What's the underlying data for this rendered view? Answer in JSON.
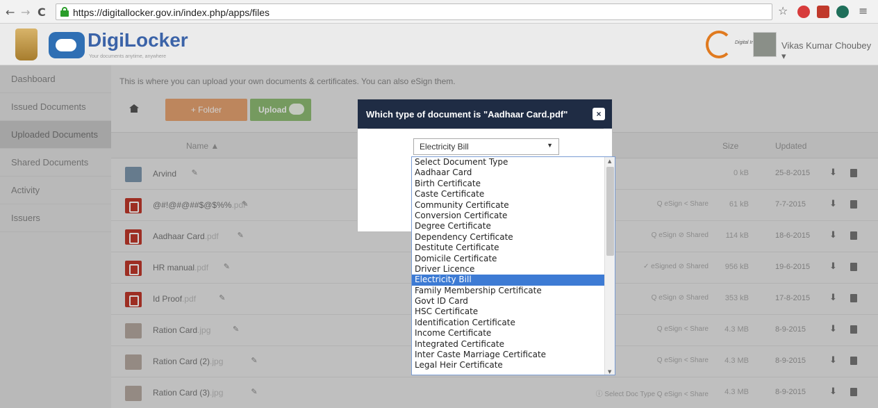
{
  "browser": {
    "url": "https://digitallocker.gov.in/index.php/apps/files",
    "back": "←",
    "forward": "→",
    "reload": "C",
    "menu": "≡",
    "star": "☆"
  },
  "header": {
    "brand": "DigiLocker",
    "tagline": "Your documents anytime, anywhere",
    "digital_india": "Digital India",
    "user_name": "Vikas Kumar Choubey ▾"
  },
  "sidebar": {
    "items": [
      {
        "label": "Dashboard"
      },
      {
        "label": "Issued Documents"
      },
      {
        "label": "Uploaded Documents"
      },
      {
        "label": "Shared Documents"
      },
      {
        "label": "Activity"
      },
      {
        "label": "Issuers"
      }
    ]
  },
  "main": {
    "intro": "This is where you can upload your own documents & certificates. You can also eSign them.",
    "folder_button": "+ Folder",
    "upload_button": "Upload",
    "columns": {
      "name": "Name ▲",
      "size": "Size",
      "updated": "Updated"
    },
    "rows": [
      {
        "name": "Arvind",
        "ext": "",
        "type": "folder",
        "actions": "",
        "size": "0 kB",
        "date": "25-8-2015"
      },
      {
        "name": "@#!@#@##$@$%%",
        "ext": ".pdf",
        "type": "pdf",
        "actions": "Q eSign  < Share",
        "size": "61 kB",
        "date": "7-7-2015"
      },
      {
        "name": "Aadhaar Card",
        "ext": ".pdf",
        "type": "pdf",
        "actions": "Q eSign  ⊘ Shared",
        "size": "114 kB",
        "date": "18-6-2015"
      },
      {
        "name": "HR manual",
        "ext": ".pdf",
        "type": "pdf",
        "actions": "✓ eSigned  ⊘ Shared",
        "size": "956 kB",
        "date": "19-6-2015"
      },
      {
        "name": "Id Proof",
        "ext": ".pdf",
        "type": "pdf",
        "actions": "Q eSign  ⊘ Shared",
        "size": "353 kB",
        "date": "17-8-2015"
      },
      {
        "name": "Ration Card",
        "ext": ".jpg",
        "type": "img",
        "actions": "Q eSign  < Share",
        "size": "4.3 MB",
        "date": "8-9-2015"
      },
      {
        "name": "Ration Card (2)",
        "ext": ".jpg",
        "type": "img",
        "actions": "Q eSign  < Share",
        "size": "4.3 MB",
        "date": "8-9-2015"
      },
      {
        "name": "Ration Card (3)",
        "ext": ".jpg",
        "type": "img",
        "actions": "ⓘ Select Doc Type  Q eSign  < Share",
        "size": "4.3 MB",
        "date": "8-9-2015"
      }
    ]
  },
  "modal": {
    "title": "Which type of document is \"Aadhaar Card.pdf\"",
    "close": "×",
    "selected": "Electricity Bill",
    "options": [
      "Select Document Type",
      "Aadhaar Card",
      "Birth Certificate",
      "Caste Certificate",
      "Community Certificate",
      "Conversion Certificate",
      "Degree Certificate",
      "Dependency Certificate",
      "Destitute Certificate",
      "Domicile Certificate",
      "Driver Licence",
      "Electricity Bill",
      "Family Membership Certificate",
      "Govt ID Card",
      "HSC Certificate",
      "Identification Certificate",
      "Income Certificate",
      "Integrated Certificate",
      "Inter Caste Marriage Certificate",
      "Legal Heir Certificate"
    ],
    "highlighted_index": 11
  }
}
